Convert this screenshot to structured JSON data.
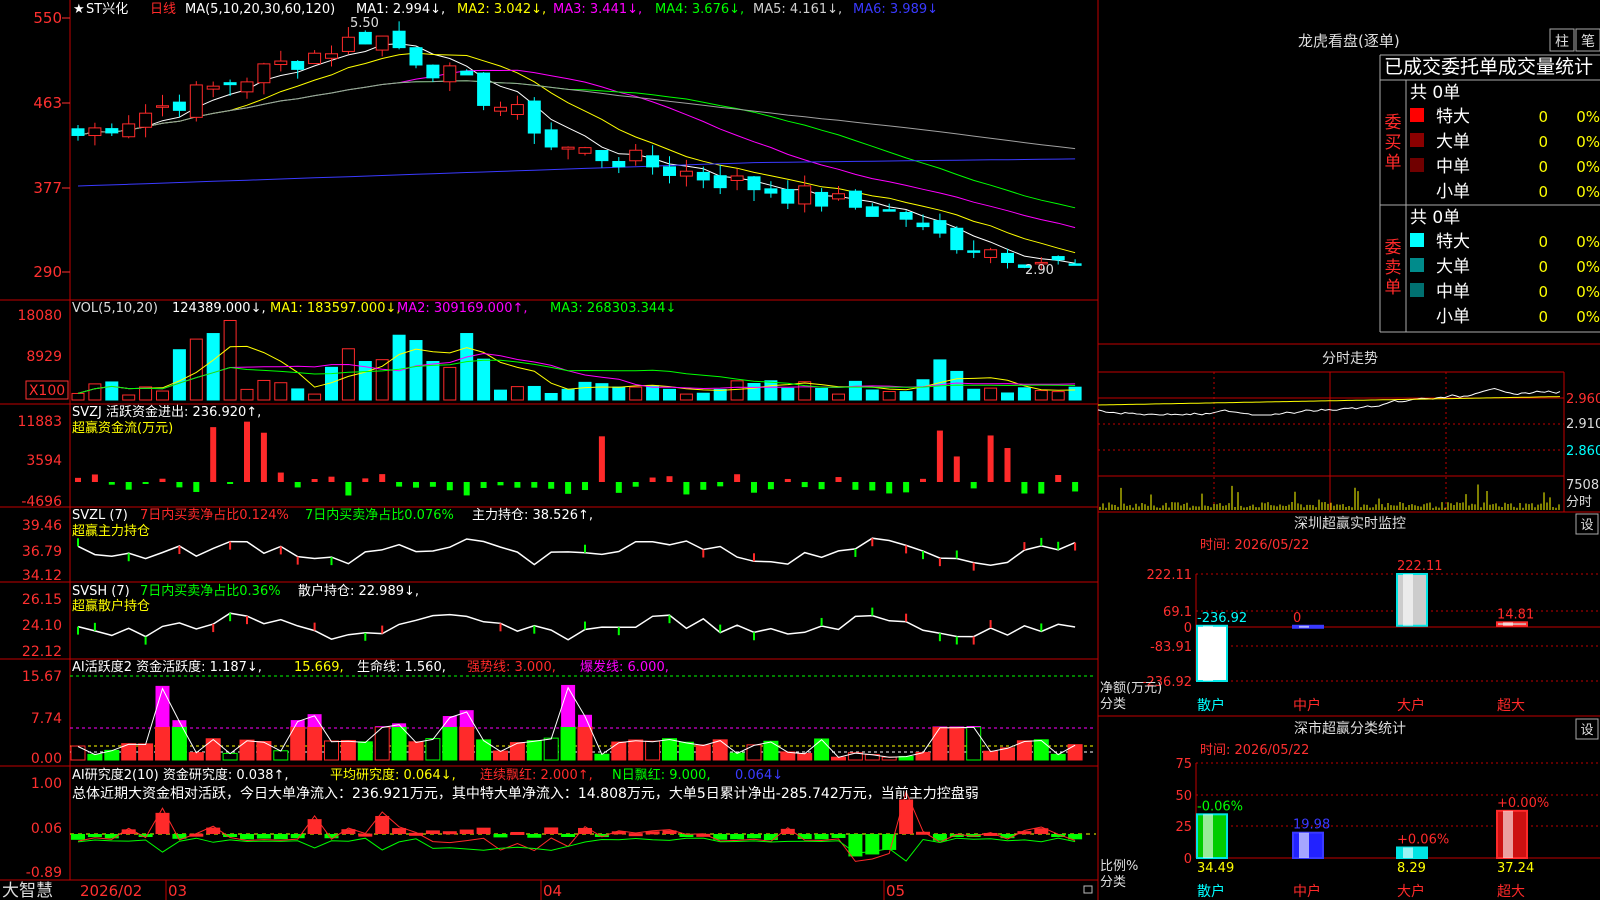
{
  "colors": {
    "up": "#ff2a2a",
    "down": "#00ffff",
    "grid": "#c00000",
    "text": "#d8d8d8",
    "yellow": "#ffff00",
    "white": "#ffffff",
    "magenta": "#ff00ff",
    "green": "#00ff00",
    "gray": "#a0a0a0",
    "blue": "#3a3aff",
    "axis": "#ff3030"
  },
  "chart_header": {
    "stock": "ST兴化",
    "period": "日线",
    "ma_params": "MA(5,10,20,30,60,120)",
    "ma1": "MA1: 2.994↓,",
    "ma2": "MA2: 3.042↓,",
    "ma3": "MA3: 3.441↓,",
    "ma4": "MA4: 3.676↓,",
    "ma5": "MA5: 4.161↓,",
    "ma6": "MA6: 3.989↓"
  },
  "price_axis": [
    "550",
    "463",
    "377",
    "290"
  ],
  "price_markers": {
    "high": "5.50",
    "low": "2.90"
  },
  "vol_header": {
    "name": "VOL(5,10,20)",
    "val": "124389.000↓,",
    "ma1": "MA1: 183597.000↓,",
    "ma2": "MA2: 309169.000↑,",
    "ma3": "MA3: 268303.344↓"
  },
  "vol_axis": [
    "18080",
    "8929"
  ],
  "vol_unit": "X100",
  "svzj": {
    "line1": "SVZJ  活跃资金进出: 236.920↑,",
    "line2": "超赢资金流(万元)",
    "axis": [
      "11883",
      "3594",
      "-4696"
    ]
  },
  "svzl": {
    "prefix": "SVZL (7)",
    "a": "7日内买卖净占比0.124%",
    "b": "7日内买卖净占比0.076%",
    "c": "主力持仓: 38.526↑,",
    "label": "超赢主力持仓",
    "axis": [
      "39.46",
      "36.79",
      "34.12"
    ]
  },
  "svsh": {
    "prefix": "SVSH (7)",
    "a": "7日内买卖净占比0.36%",
    "c": "散户持仓: 22.989↓,",
    "label": "超赢散户持仓",
    "axis": [
      "26.15",
      "24.10",
      "22.12"
    ]
  },
  "ai1": {
    "a": "AI活跃度2 资金活跃度: 1.187↓,",
    "b": "15.669,",
    "c": "生命线: 1.560,",
    "d": "强势线: 3.000,",
    "e": "爆发线: 6.000,",
    "axis": [
      "15.67",
      "7.74",
      "0.00"
    ]
  },
  "ai2": {
    "a": "AI研究度2(10) 资金研究度: 0.038↑,",
    "b": "平均研究度: 0.064↓,",
    "c": "连续飘红: 2.000↑,",
    "d": "N日飘红: 9.000,",
    "e": "0.064↓",
    "summary": "总体近期大资金相对活跃，今日大单净流入：236.921万元，其中特大单净流入：14.808万元，大单5日累计净出-285.742万元，当前主力控盘弱",
    "axis": [
      "1.00",
      "0.06",
      "-0.89"
    ]
  },
  "date_axis": {
    "logo": "大智慧",
    "d1": "2026/02",
    "d2": "03",
    "d3": "04",
    "d4": "05"
  },
  "lhkp": {
    "title": "龙虎看盘(逐单)",
    "btn1": "柱",
    "btn2": "笔",
    "subtitle": "已成交委托单成交量统计",
    "buy_label": "委买单",
    "sell_label": "委卖单",
    "buy_total": "共 0单",
    "sell_total": "共 0单",
    "buy_rows": [
      {
        "name": "特大",
        "count": "0",
        "pct": "0%"
      },
      {
        "name": "大单",
        "count": "0",
        "pct": "0%"
      },
      {
        "name": "中单",
        "count": "0",
        "pct": "0%"
      },
      {
        "name": "小单",
        "count": "0",
        "pct": "0%"
      }
    ],
    "sell_rows": [
      {
        "name": "特大",
        "count": "0",
        "pct": "0%"
      },
      {
        "name": "大单",
        "count": "0",
        "pct": "0%"
      },
      {
        "name": "中单",
        "count": "0",
        "pct": "0%"
      },
      {
        "name": "小单",
        "count": "0",
        "pct": "0%"
      }
    ]
  },
  "fenshi": {
    "title": "分时走势",
    "axis": [
      "2.960",
      "2.910",
      "2.860"
    ],
    "vol_label": "7508",
    "vol_unit": "分时"
  },
  "monitor": {
    "title": "深圳超赢实时监控",
    "btn": "设",
    "time": "时间: 2026/05/22",
    "axis": [
      "222.11",
      "69.1",
      "0",
      "-83.91",
      "-236.92"
    ],
    "unit": "净额(万元)",
    "cat_label": "分类",
    "categories": [
      "散户",
      "中户",
      "大户",
      "超大"
    ],
    "values": [
      -236.92,
      0,
      222.11,
      14.81
    ],
    "labels": [
      "-236.92",
      "0",
      "222.11",
      "14.81"
    ]
  },
  "classify": {
    "title": "深市超赢分类统计",
    "btn": "设",
    "time": "时间: 2026/05/22",
    "axis": [
      "75",
      "50",
      "25",
      "0"
    ],
    "unit": "比例%",
    "cat_label": "分类",
    "categories": [
      "散户",
      "中户",
      "大户",
      "超大"
    ],
    "values": [
      34.49,
      19.98,
      8.29,
      37.24
    ],
    "labels": [
      "34.49",
      "19.98",
      "8.29",
      "37.24"
    ],
    "changes": [
      "-0.06%",
      "",
      "+0.06%",
      "+0.00%"
    ]
  }
}
